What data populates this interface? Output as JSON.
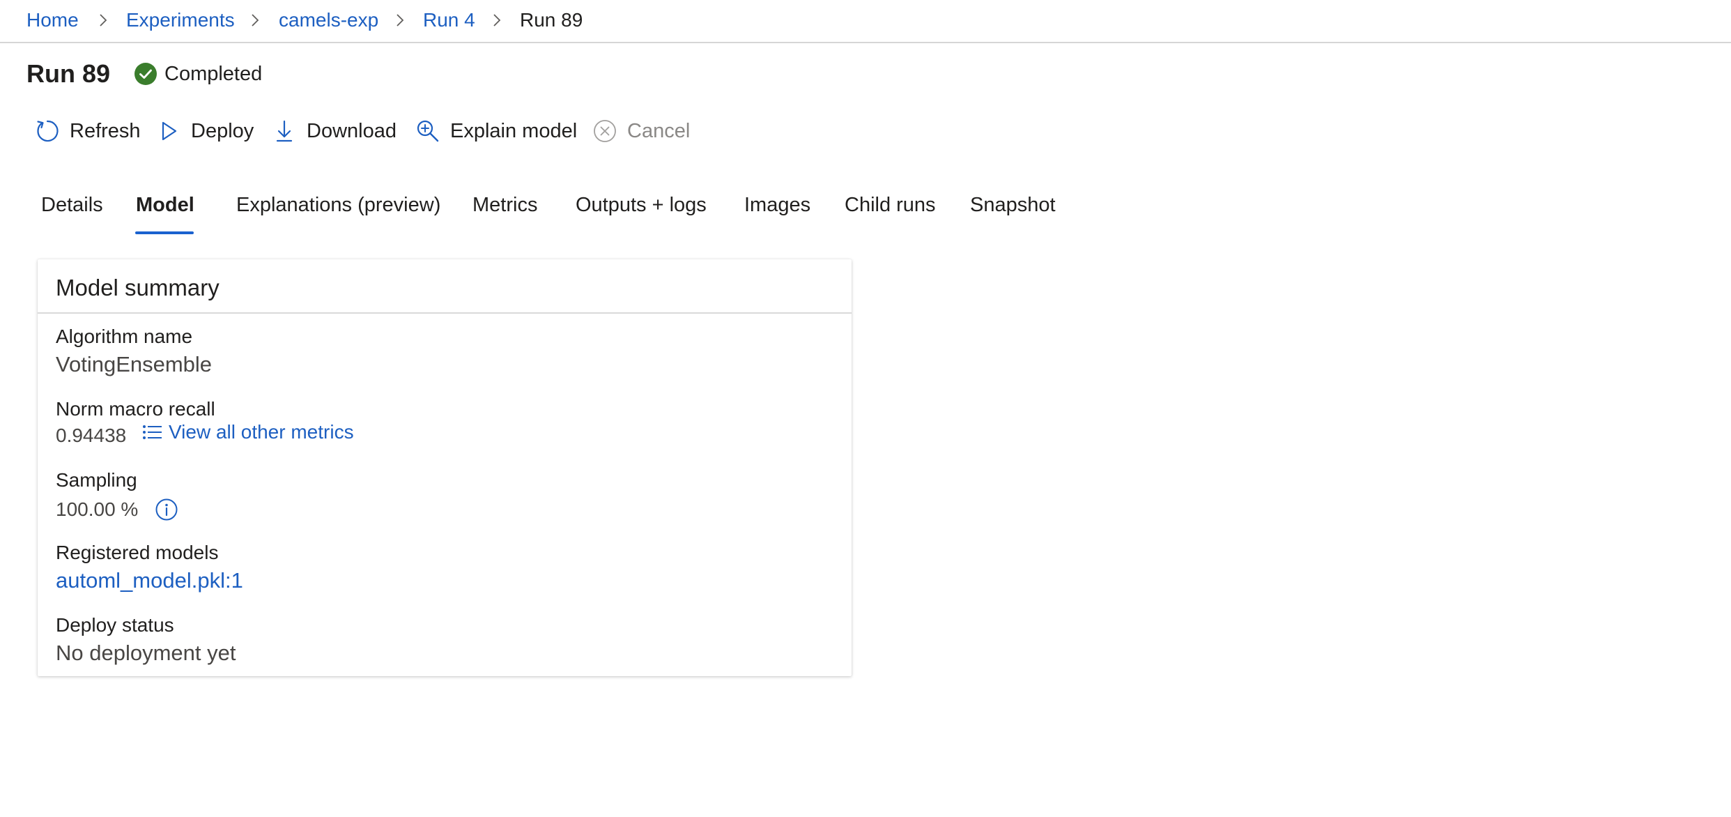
{
  "breadcrumb": {
    "items": [
      {
        "label": "Home"
      },
      {
        "label": "Experiments"
      },
      {
        "label": "camels-exp"
      },
      {
        "label": "Run 4"
      },
      {
        "label": "Run 89"
      }
    ],
    "separator_icon": "chevron-right-icon"
  },
  "header": {
    "title": "Run 89",
    "status": "Completed",
    "status_icon": "check-circle-icon",
    "status_color": "#3a7d2c"
  },
  "toolbar": {
    "refresh_label": "Refresh",
    "deploy_label": "Deploy",
    "download_label": "Download",
    "explain_label": "Explain model",
    "cancel_label": "Cancel"
  },
  "tabs": {
    "details": "Details",
    "model": "Model",
    "explanations": "Explanations (preview)",
    "metrics": "Metrics",
    "outputs": "Outputs + logs",
    "images": "Images",
    "child_runs": "Child runs",
    "snapshot": "Snapshot",
    "active": "Model"
  },
  "model_summary": {
    "title": "Model summary",
    "algorithm_label": "Algorithm name",
    "algorithm_value": "VotingEnsemble",
    "recall_label": "Norm macro recall",
    "recall_value": "0.94438",
    "metrics_link": "View all other metrics",
    "sampling_label": "Sampling",
    "sampling_value": "100.00 %",
    "registered_label": "Registered models",
    "registered_value": "automl_model.pkl:1",
    "deploy_label": "Deploy status",
    "deploy_value": "No deployment yet"
  },
  "colors": {
    "link": "#1d5fc1",
    "accent": "#1a62cf",
    "success": "#3a7d2c",
    "disabled": "#8a8886"
  }
}
